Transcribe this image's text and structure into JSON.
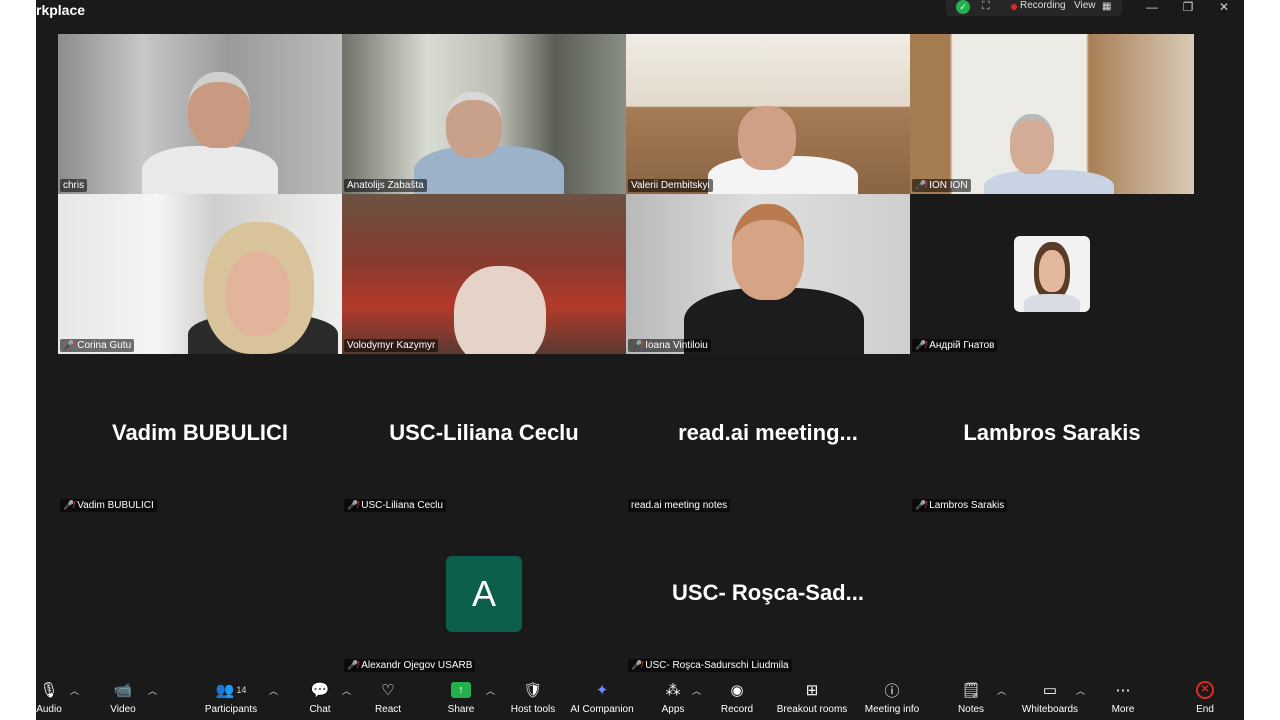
{
  "window": {
    "title": "rkplace"
  },
  "status": {
    "recording_label": "Recording",
    "view_label": "View",
    "view_icon": "grid-icon"
  },
  "window_controls": {
    "minimize": "—",
    "restore": "❐",
    "close": "✕"
  },
  "video_tiles": [
    {
      "name": "chris",
      "muted": false
    },
    {
      "name": "Anatolijs Zabašta",
      "muted": false
    },
    {
      "name": "Valerii Dembitskyi",
      "muted": false
    },
    {
      "name": "ION ION",
      "muted": true
    },
    {
      "name": "Corina Gutu",
      "muted": true
    },
    {
      "name": "Volodymyr Kazymyr",
      "muted": false,
      "active_speaker": true
    },
    {
      "name": "Ioana Vintiloiu",
      "muted": true
    },
    {
      "name": "Андрій Гнатов",
      "muted": true
    }
  ],
  "name_tiles": [
    {
      "display": "Vadim BUBULICI",
      "tag": "Vadim BUBULICI",
      "muted": true
    },
    {
      "display": "USC-Liliana Ceclu",
      "tag": "USC-Liliana Ceclu",
      "muted": true
    },
    {
      "display": "read.ai  meeting...",
      "tag": "read.ai meeting notes",
      "muted": false
    },
    {
      "display": "Lambros Sarakis",
      "tag": "Lambros Sarakis",
      "muted": true
    },
    {
      "display": "USC-  Roşca-Sad...",
      "tag": "USC- Roşca-Sadurschi Liudmila",
      "muted": true
    }
  ],
  "avatar_tile": {
    "letter": "A",
    "tag": "Alexandr Ojegov USARB",
    "muted": true
  },
  "toolbar": {
    "audio": "Audio",
    "video": "Video",
    "participants": "Participants",
    "participants_count": "14",
    "chat": "Chat",
    "react": "React",
    "share": "Share",
    "host_tools": "Host tools",
    "ai_companion": "AI Companion",
    "apps": "Apps",
    "record": "Record",
    "breakout_rooms": "Breakout rooms",
    "meeting_info": "Meeting info",
    "notes": "Notes",
    "whiteboards": "Whiteboards",
    "more": "More",
    "end": "End"
  },
  "colors": {
    "accent_green": "#23b14d",
    "active_outline": "#2fd39a",
    "mute_red": "#e5423b",
    "end_red": "#e02828",
    "avatar_bg": "#0c5e4d"
  }
}
